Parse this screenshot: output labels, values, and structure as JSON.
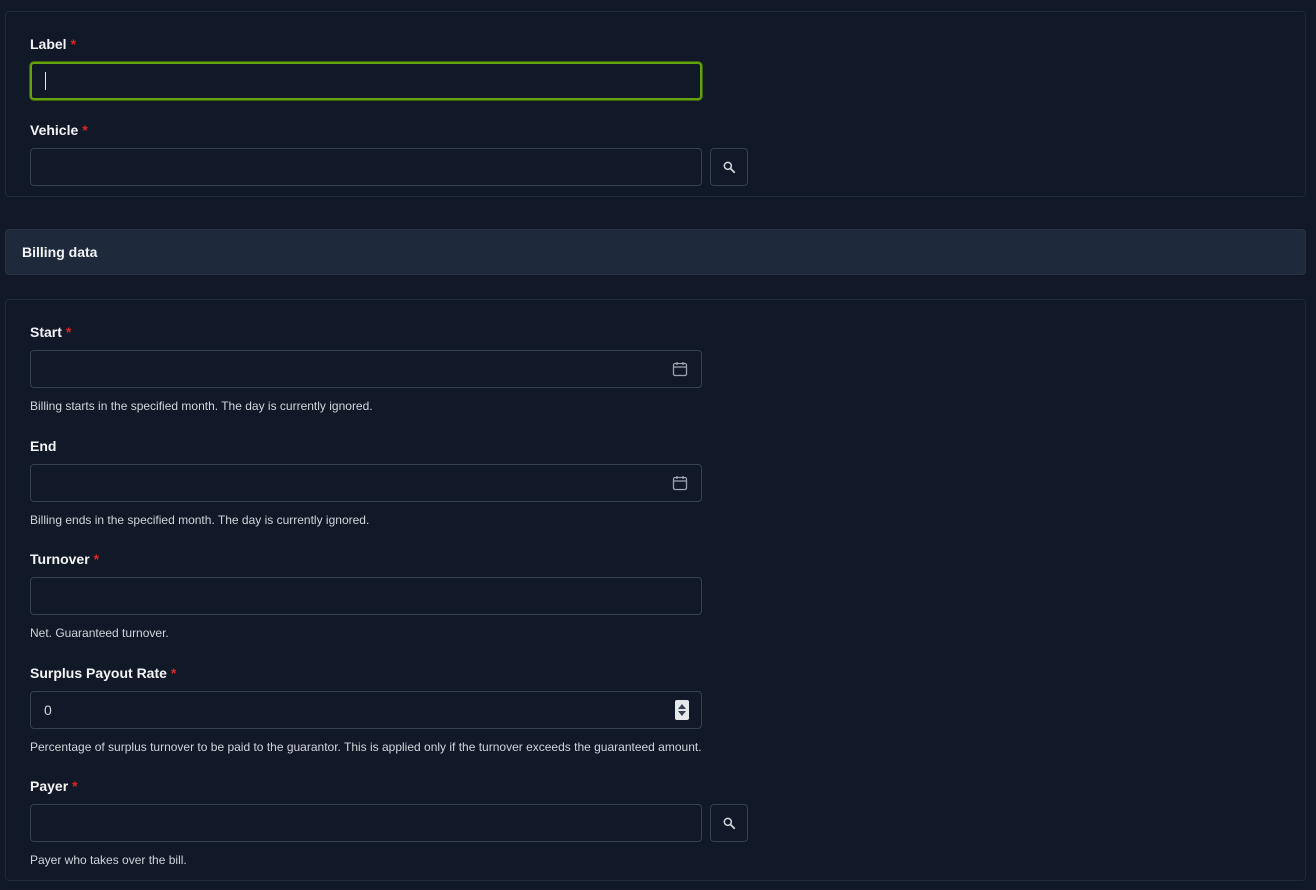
{
  "vehicle_section": {
    "label_field": {
      "label": "Label",
      "required_mark": "*",
      "value": ""
    },
    "vehicle_field": {
      "label": "Vehicle",
      "required_mark": "*",
      "value": ""
    }
  },
  "billing_section": {
    "title": "Billing data",
    "start": {
      "label": "Start",
      "required_mark": "*",
      "value": "",
      "help": "Billing starts in the specified month. The day is currently ignored."
    },
    "end": {
      "label": "End",
      "value": "",
      "help": "Billing ends in the specified month. The day is currently ignored."
    },
    "turnover": {
      "label": "Turnover",
      "required_mark": "*",
      "value": "",
      "help": "Net. Guaranteed turnover."
    },
    "surplus_rate": {
      "label": "Surplus Payout Rate",
      "required_mark": "*",
      "value": "0",
      "help": "Percentage of surplus turnover to be paid to the guarantor. This is applied only if the turnover exceeds the guaranteed amount."
    },
    "payer": {
      "label": "Payer",
      "required_mark": "*",
      "value": "",
      "help": "Payer who takes over the bill."
    }
  },
  "icons": {
    "search": "search-icon",
    "calendar": "calendar-icon"
  },
  "colors": {
    "focus_ring": "#65a30d",
    "required": "#dc2626",
    "background": "#111827",
    "section_header": "#1e293b"
  }
}
